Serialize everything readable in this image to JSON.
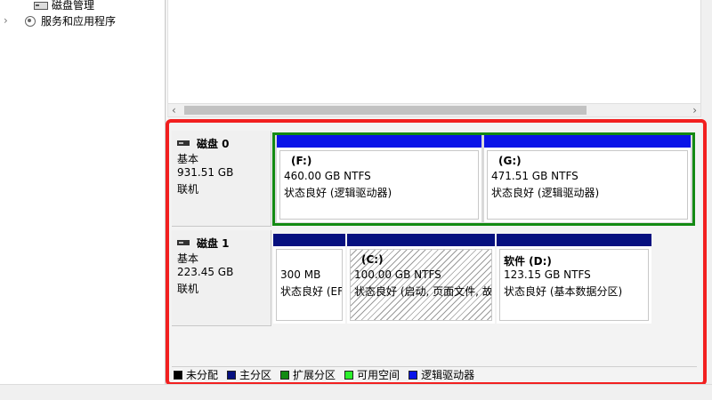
{
  "tree": {
    "disk_management": "磁盘管理",
    "services": "服务和应用程序"
  },
  "disks": [
    {
      "name": "磁盘 0",
      "type": "基本",
      "size": "931.51 GB",
      "status": "联机",
      "partitions": [
        {
          "name": "(F:)",
          "size": "460.00 GB NTFS",
          "status": "状态良好 (逻辑驱动器)",
          "bar_color": "#0a14e8"
        },
        {
          "name": "(G:)",
          "size": "471.51 GB NTFS",
          "status": "状态良好 (逻辑驱动器)",
          "bar_color": "#0a14e8"
        }
      ]
    },
    {
      "name": "磁盘 1",
      "type": "基本",
      "size": "223.45 GB",
      "status": "联机",
      "partitions": [
        {
          "name": "",
          "size": "300 MB",
          "status": "状态良好 (EF",
          "bar_color": "#06107f"
        },
        {
          "name": "(C:)",
          "size": "100.00 GB NTFS",
          "status": "状态良好 (启动, 页面文件, 故",
          "bar_color": "#06107f"
        },
        {
          "name": "软件  (D:)",
          "size": "123.15 GB NTFS",
          "status": "状态良好 (基本数据分区)",
          "bar_color": "#06107f"
        }
      ]
    }
  ],
  "legend": [
    {
      "label": "未分配",
      "color": "#000000"
    },
    {
      "label": "主分区",
      "color": "#06107f"
    },
    {
      "label": "扩展分区",
      "color": "#138a13"
    },
    {
      "label": "可用空间",
      "color": "#2cf02c"
    },
    {
      "label": "逻辑驱动器",
      "color": "#0a14e8"
    }
  ],
  "scroll": {
    "left": "‹",
    "right": "›"
  },
  "colors": {
    "highlight": "#f22020",
    "extended": "#138a13"
  }
}
